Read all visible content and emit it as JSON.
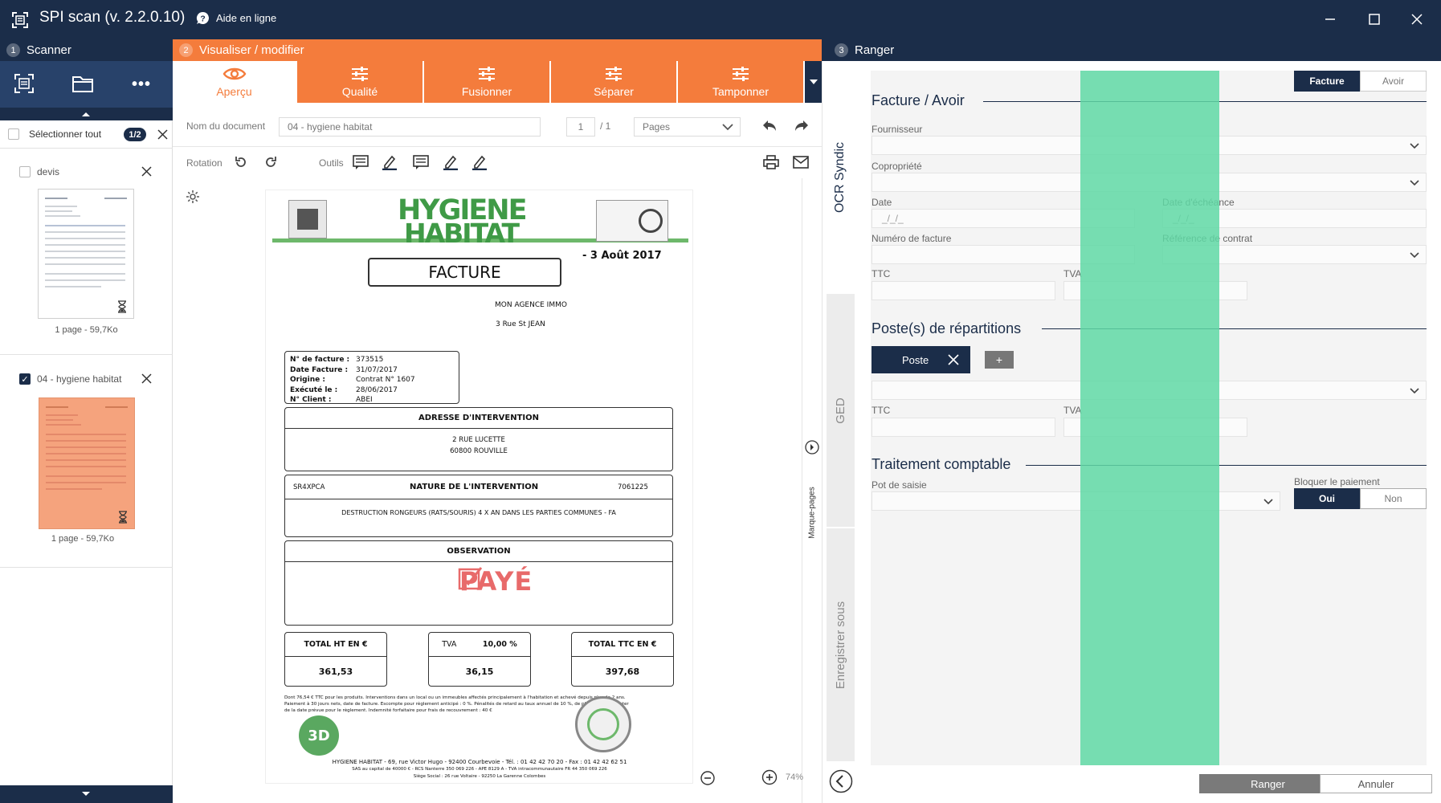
{
  "app": {
    "title": "SPI scan (v. 2.2.0.10)",
    "help": "Aide en ligne"
  },
  "sections": {
    "scanner": {
      "num": "1",
      "label": "Scanner"
    },
    "visualiser": {
      "num": "2",
      "label": "Visualiser / modifier"
    },
    "ranger": {
      "num": "3",
      "label": "Ranger"
    }
  },
  "colors": {
    "navy": "#1b2d49",
    "orange": "#f47c3c",
    "green": "#5fd8a4"
  },
  "left": {
    "select_all": "Sélectionner tout",
    "count_badge": "1/2",
    "docs": [
      {
        "name": "devis",
        "info": "1 page - 59,7Ko",
        "checked": false
      },
      {
        "name": "04 - hygiene habitat",
        "info": "1 page - 59,7Ko",
        "checked": true
      }
    ]
  },
  "tabs": [
    "Aperçu",
    "Qualité",
    "Fusionner",
    "Séparer",
    "Tamponner"
  ],
  "toolbar": {
    "doc_name_label": "Nom du document",
    "doc_name_value": "04 - hygiene habitat",
    "page_current": "1",
    "page_total": "/ 1",
    "pages_select": "Pages",
    "rotation_label": "Rotation",
    "tools_label": "Outils",
    "zoom": "74%"
  },
  "side_tabs": {
    "ocr": "OCR Syndic",
    "ged": "GED",
    "save_as": "Enregistrer sous",
    "bookmarks": "Marque-pages"
  },
  "invoice": {
    "company_line1": "HYGIENE",
    "company_line2": "HABITAT",
    "date_stamp": "- 3 Août 2017",
    "title": "FACTURE",
    "recipient_1": "MON AGENCE IMMO",
    "recipient_2": "3 Rue St JEAN",
    "info_labels": [
      "N° de facture :",
      "Date Facture :",
      "Origine :",
      "Exécuté le :",
      "N° Client :"
    ],
    "info_values": [
      "373515",
      "31/07/2017",
      "Contrat N° 1607",
      "28/06/2017",
      "ABEI"
    ],
    "address_title": "ADRESSE D'INTERVENTION",
    "address_1": "2 RUE LUCETTE",
    "address_2": "60800 ROUVILLE",
    "nature_code": "SR4XPCA",
    "nature_title": "NATURE DE L'INTERVENTION",
    "nature_number": "7061225",
    "nature_desc": "DESTRUCTION RONGEURS (RATS/SOURIS) 4 X AN DANS LES PARTIES COMMUNES - FA",
    "observation_title": "OBSERVATION",
    "paid_stamp": "PAYÉ",
    "total_ht_label": "TOTAL HT EN €",
    "total_ht": "361,53",
    "tva_label": "TVA",
    "tva_rate": "10,00 %",
    "tva_value": "36,15",
    "total_ttc_label": "TOTAL TTC EN €",
    "total_ttc": "397,68",
    "fine_print_1": "Dont 76,54 € TTC pour les produits. Interventions dans un local ou un immeubles affectés principalement à l'habitation et achevé depuis plus de 2 ans.",
    "fine_print_2": "Paiement à 30 jours nets, date de facture. Escompte pour règlement anticipé : 0 %. Pénalités de retard au taux annuel de 10 %, de plein droit à compter",
    "fine_print_3": "de la date prévue pour le règlement. Indemnité forfaitaire pour frais de recouvrement : 40 €",
    "footer_1": "HYGIENE HABITAT - 69, rue Victor Hugo - 92400 Courbevoie - Tél. : 01 42 42 70 20 - Fax : 01 42 42 62 51",
    "footer_2": "SAS au capital de 40000 € - RCS Nanterre 350 069 226 - APE 8129 A - TVA intracommunautaire FR 44 350 069 226",
    "footer_3": "Siège Social : 26 rue Voltaire - 92250 La Garenne Colombes",
    "badge_3d": "3D"
  },
  "form": {
    "toggle": [
      "Facture",
      "Avoir"
    ],
    "section1": "Facture / Avoir",
    "fournisseur": "Fournisseur",
    "copropriete": "Copropriété",
    "date": "Date",
    "date_placeholder": "_/_/_",
    "date_echeance": "Date d'échéance",
    "date_echeance_placeholder": "_/_/_",
    "numero_facture": "Numéro de facture",
    "reference_contrat": "Référence de contrat",
    "ttc": "TTC",
    "tva": "TVA",
    "section2": "Poste(s) de répartitions",
    "poste": "Poste",
    "add": "+",
    "ttc2": "TTC",
    "tva2": "TVA",
    "section3": "Traitement comptable",
    "pot_saisie": "Pot de saisie",
    "bloquer": "Bloquer le paiement",
    "oui": "Oui",
    "non": "Non"
  },
  "footer": {
    "ranger": "Ranger",
    "annuler": "Annuler"
  }
}
